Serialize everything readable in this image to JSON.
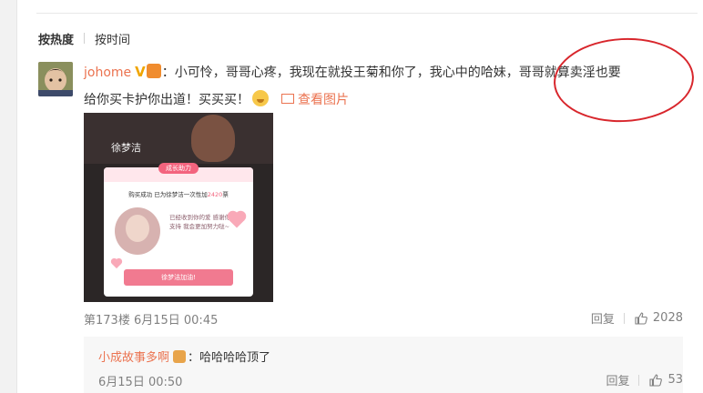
{
  "sort": {
    "hot_label": "按热度",
    "time_label": "按时间"
  },
  "comment": {
    "username": "johome",
    "badge_v": "V",
    "text_line1": "：小可怜，哥哥心疼，我现在就投王菊和你了，我心中的哈妹，哥哥就算卖淫也要",
    "text_line2": "给你买卡护你出道！买买买！",
    "view_pic_label": "查看图片",
    "floor_time": "第173楼 6月15日 00:45",
    "reply_label": "回复",
    "like_count": "2028",
    "image": {
      "name": "徐梦洁",
      "tag": "成长助力",
      "success_text": "购买成功 已为徐梦洁一次性加",
      "votes": "2420",
      "votes_unit": "票",
      "handwriting": "已经收到你的爱 感谢你的支持 我会更加努力哒~",
      "button_label": "徐梦洁加油!"
    }
  },
  "reply": {
    "username": "小成故事多啊",
    "text": "：哈哈哈哈顶了",
    "time": "6月15日 00:50",
    "reply_label": "回复",
    "like_count": "53"
  },
  "colors": {
    "link": "#eb7350",
    "highlight_circle": "#d8262c",
    "meta": "#808080"
  }
}
